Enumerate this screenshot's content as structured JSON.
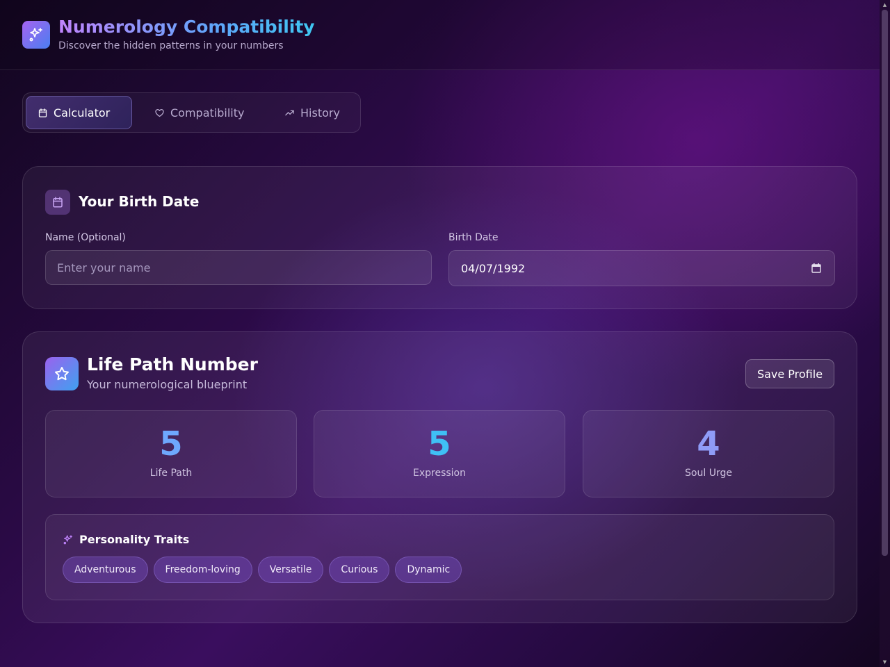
{
  "header": {
    "title": "Numerology Compatibility",
    "subtitle": "Discover the hidden patterns in your numbers",
    "logo_icon": "sparkles-icon"
  },
  "tabs": [
    {
      "label": "Calculator",
      "icon": "calendar-icon",
      "active": true
    },
    {
      "label": "Compatibility",
      "icon": "heart-icon",
      "active": false
    },
    {
      "label": "History",
      "icon": "trending-up-icon",
      "active": false
    }
  ],
  "birth_card": {
    "title": "Your Birth Date",
    "name_label": "Name (Optional)",
    "name_value": "",
    "name_placeholder": "Enter your name",
    "date_label": "Birth Date",
    "date_value": "04/07/1992"
  },
  "life_path_card": {
    "title": "Life Path Number",
    "subtitle": "Your numerological blueprint",
    "save_label": "Save Profile",
    "stats": [
      {
        "value": "5",
        "label": "Life Path",
        "color": "#6ea8fe"
      },
      {
        "value": "5",
        "label": "Expression",
        "color": "#3fc0f5"
      },
      {
        "value": "4",
        "label": "Soul Urge",
        "color": "#8f9cf7"
      }
    ],
    "traits": {
      "title": "Personality Traits",
      "items": [
        "Adventurous",
        "Freedom-loving",
        "Versatile",
        "Curious",
        "Dynamic"
      ]
    }
  }
}
